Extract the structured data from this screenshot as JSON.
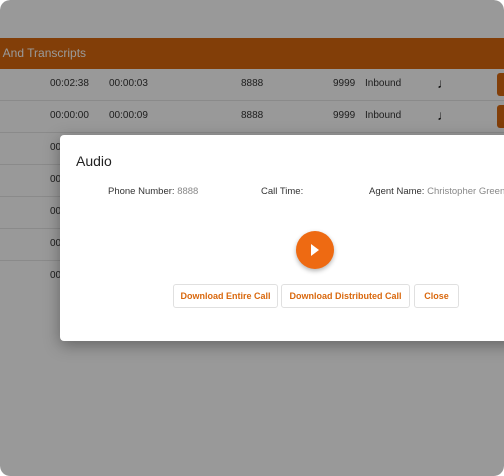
{
  "panel": {
    "title": "s And Transcripts"
  },
  "rows": [
    {
      "duration": "00:02:38",
      "wait": "00:00:03",
      "from": "8888",
      "to": "9999",
      "direction": "Inbound",
      "icon": "music-note-icon"
    },
    {
      "duration": "00:00:00",
      "wait": "00:00:09",
      "from": "8888",
      "to": "9999",
      "direction": "Inbound",
      "icon": "music-note-icon"
    },
    {
      "duration": "00",
      "wait": "",
      "from": "",
      "to": "",
      "direction": "",
      "icon": ""
    },
    {
      "duration": "00",
      "wait": "",
      "from": "",
      "to": "",
      "direction": "",
      "icon": ""
    },
    {
      "duration": "00",
      "wait": "",
      "from": "",
      "to": "",
      "direction": "",
      "icon": ""
    },
    {
      "duration": "00",
      "wait": "",
      "from": "",
      "to": "",
      "direction": "",
      "icon": ""
    },
    {
      "duration": "00",
      "wait": "",
      "from": "",
      "to": "",
      "direction": "",
      "icon": ""
    }
  ],
  "modal": {
    "title": "Audio",
    "phone_label": "Phone Number:",
    "phone_value": "8888",
    "call_time_label": "Call Time:",
    "call_time_value": "",
    "agent_label": "Agent Name:",
    "agent_value": "Christopher Greenv",
    "play_icon": "play-icon",
    "buttons": {
      "download_entire": "Download Entire Call",
      "download_distributed": "Download Distributed Call",
      "close": "Close"
    }
  },
  "colors": {
    "accent": "#d9680e",
    "play": "#ee6a12"
  }
}
